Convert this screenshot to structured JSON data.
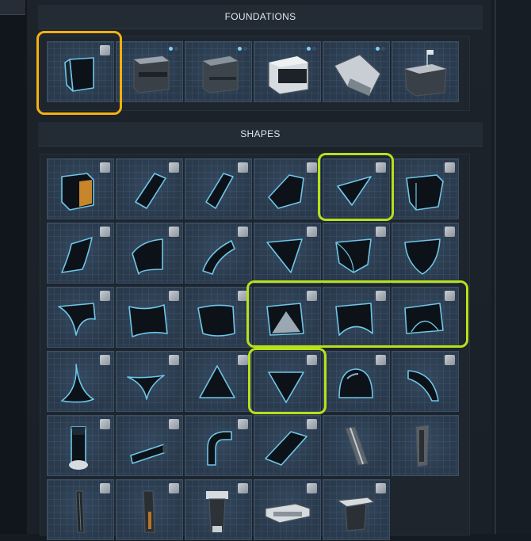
{
  "sections": {
    "foundations": {
      "title": "FOUNDATIONS"
    },
    "shapes": {
      "title": "SHAPES"
    }
  },
  "colors": {
    "selection": "#f5b00e",
    "highlight": "#b7e01b",
    "tile_bg": "#2a3a4c",
    "variant_dot_active": "#7fd0ff",
    "variant_dot_inactive": "#3c4e60"
  },
  "foundations": [
    {
      "icon": "cube-foundation-icon",
      "selected": true
    },
    {
      "icon": "metal-foundation-icon",
      "variants": true
    },
    {
      "icon": "steel-foundation-icon",
      "variants": true
    },
    {
      "icon": "framed-foundation-icon",
      "variants": true
    },
    {
      "icon": "ramp-foundation-icon",
      "variants": true
    },
    {
      "icon": "flag-foundation-icon"
    }
  ],
  "shapes": [
    {
      "icon": "cube-orange-face-icon"
    },
    {
      "icon": "wedge-panel-icon"
    },
    {
      "icon": "slanted-panel-icon"
    },
    {
      "icon": "slope-block-icon"
    },
    {
      "icon": "wedge-triangle-icon",
      "highlighted": true
    },
    {
      "icon": "cube-shape-icon"
    },
    {
      "icon": "curved-wall-icon"
    },
    {
      "icon": "quarter-pipe-icon"
    },
    {
      "icon": "curved-panel-icon"
    },
    {
      "icon": "pyramid-corner-icon"
    },
    {
      "icon": "inverted-corner-icon"
    },
    {
      "icon": "rounded-corner-icon"
    },
    {
      "icon": "flared-corner-icon"
    },
    {
      "icon": "concave-wall-icon"
    },
    {
      "icon": "rounded-wall-icon"
    },
    {
      "icon": "pyramid-cutout-icon",
      "highlighted": true
    },
    {
      "icon": "double-curve-icon",
      "highlighted": true
    },
    {
      "icon": "arch-block-icon",
      "highlighted": true
    },
    {
      "icon": "cone-spike-icon"
    },
    {
      "icon": "thin-wedge-icon"
    },
    {
      "icon": "triangle-up-icon"
    },
    {
      "icon": "triangle-down-icon",
      "highlighted": true
    },
    {
      "icon": "dome-icon"
    },
    {
      "icon": "horn-curve-icon"
    },
    {
      "icon": "pillar-base-icon"
    },
    {
      "icon": "tube-segment-icon"
    },
    {
      "icon": "bent-pipe-icon"
    },
    {
      "icon": "slanted-plate-icon"
    },
    {
      "icon": "strut-beam-icon"
    },
    {
      "icon": "vertical-beam-icon"
    },
    {
      "icon": "pipe-post-icon"
    },
    {
      "icon": "tall-post-icon"
    },
    {
      "icon": "console-pillar-icon"
    },
    {
      "icon": "flat-slab-icon"
    },
    {
      "icon": "pedestal-icon"
    }
  ]
}
